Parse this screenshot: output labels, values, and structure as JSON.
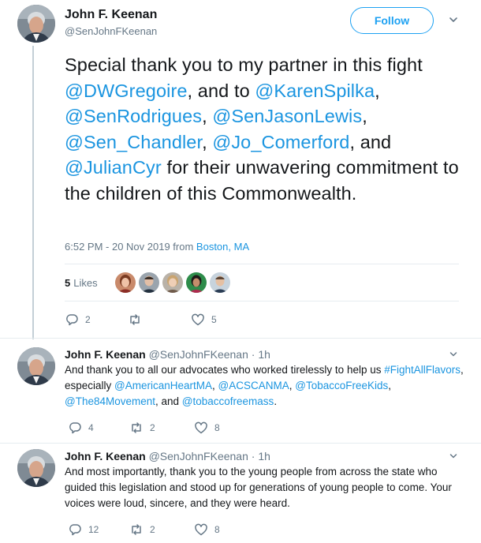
{
  "main_tweet": {
    "name": "John F. Keenan",
    "handle": "@SenJohnFKeenan",
    "follow_label": "Follow",
    "text_segments": [
      {
        "t": "Special thank you to my partner in this fight ",
        "link": false
      },
      {
        "t": "@DWGregoire",
        "link": true
      },
      {
        "t": ", and to ",
        "link": false
      },
      {
        "t": "@KarenSpilka",
        "link": true
      },
      {
        "t": ", ",
        "link": false
      },
      {
        "t": "@SenRodrigues",
        "link": true
      },
      {
        "t": ", ",
        "link": false
      },
      {
        "t": "@SenJasonLewis",
        "link": true
      },
      {
        "t": ", ",
        "link": false
      },
      {
        "t": "@Sen_Chandler",
        "link": true
      },
      {
        "t": ", ",
        "link": false
      },
      {
        "t": "@Jo_Comerford",
        "link": true
      },
      {
        "t": ", and ",
        "link": false
      },
      {
        "t": "@JulianCyr",
        "link": true
      },
      {
        "t": " for their unwavering commitment to the children of this Commonwealth.",
        "link": false
      }
    ],
    "timestamp": "6:52 PM - 20 Nov 2019 from ",
    "location": "Boston, MA",
    "likes_count": "5",
    "likes_label": "Likes",
    "reply_count": "2",
    "retweet_count": "",
    "like_count": "5"
  },
  "replies": [
    {
      "name": "John F. Keenan",
      "handle": "@SenJohnFKeenan · 1h",
      "text_segments": [
        {
          "t": "And thank you to all our advocates who worked tirelessly to help us ",
          "link": false
        },
        {
          "t": "#FightAllFlavors",
          "link": true
        },
        {
          "t": ", especially ",
          "link": false
        },
        {
          "t": "@AmericanHeartMA",
          "link": true
        },
        {
          "t": ", ",
          "link": false
        },
        {
          "t": "@ACSCANMA",
          "link": true
        },
        {
          "t": ", ",
          "link": false
        },
        {
          "t": "@TobaccoFreeKids",
          "link": true
        },
        {
          "t": ", ",
          "link": false
        },
        {
          "t": "@The84Movement",
          "link": true
        },
        {
          "t": ", and ",
          "link": false
        },
        {
          "t": "@tobaccofreemass",
          "link": true
        },
        {
          "t": ".",
          "link": false
        }
      ],
      "reply_count": "4",
      "retweet_count": "2",
      "like_count": "8"
    },
    {
      "name": "John F. Keenan",
      "handle": "@SenJohnFKeenan · 1h",
      "text_segments": [
        {
          "t": "And most importantly, thank you to the young people from across the state who guided this legislation and stood up for generations of young people to come. Your voices were loud, sincere, and they were heard.",
          "link": false
        }
      ],
      "reply_count": "12",
      "retweet_count": "2",
      "like_count": "8"
    }
  ],
  "colors": {
    "accent": "#1da1f2",
    "link": "#1b95e0",
    "muted": "#657786",
    "text": "#14171a",
    "divider": "#e6ecf0"
  },
  "icons": {
    "reply": "reply-icon",
    "retweet": "retweet-icon",
    "like": "heart-icon",
    "caret": "chevron-down-icon"
  }
}
